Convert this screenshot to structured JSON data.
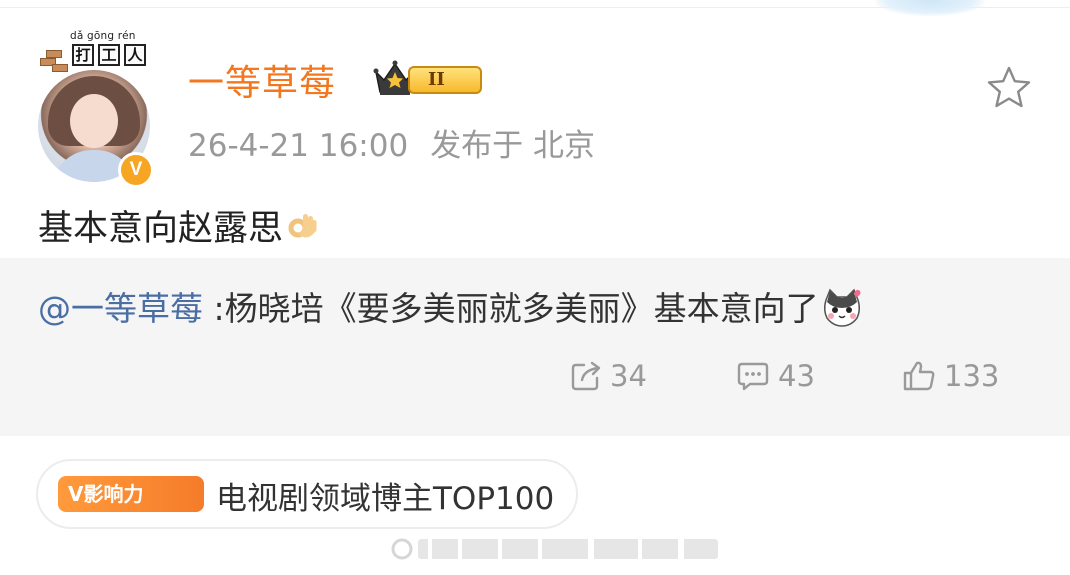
{
  "header": {
    "avatar_caption_pinyin": "dǎ gōng rén",
    "avatar_caption_chars": [
      "打",
      "工",
      "人"
    ]
  },
  "user": {
    "name": "一等草莓",
    "member_level": "II",
    "verified_mark": "V",
    "post_time": "26-4-21 16:00",
    "location": "发布于 北京"
  },
  "post": {
    "text": "基本意向赵露思",
    "emoji": "ok-hand-emoji"
  },
  "repost": {
    "mention": "@一等草莓",
    "text": " :杨晓培《要多美丽就多美丽》基本意向了",
    "emoji": "cat-face-emoji",
    "share_count": "34",
    "comment_count": "43",
    "like_count": "133"
  },
  "influence": {
    "chip_label": "V影响力",
    "label": "电视剧领域博主TOP100"
  },
  "colors": {
    "username": "#f2771f",
    "mention": "#4a6ea4",
    "meta": "#999999",
    "repost_bg": "#f5f5f5",
    "chip": "#f57c2a"
  },
  "icons": [
    "star-icon",
    "share-icon",
    "comment-icon",
    "like-icon",
    "crown-icon",
    "verified-icon"
  ]
}
